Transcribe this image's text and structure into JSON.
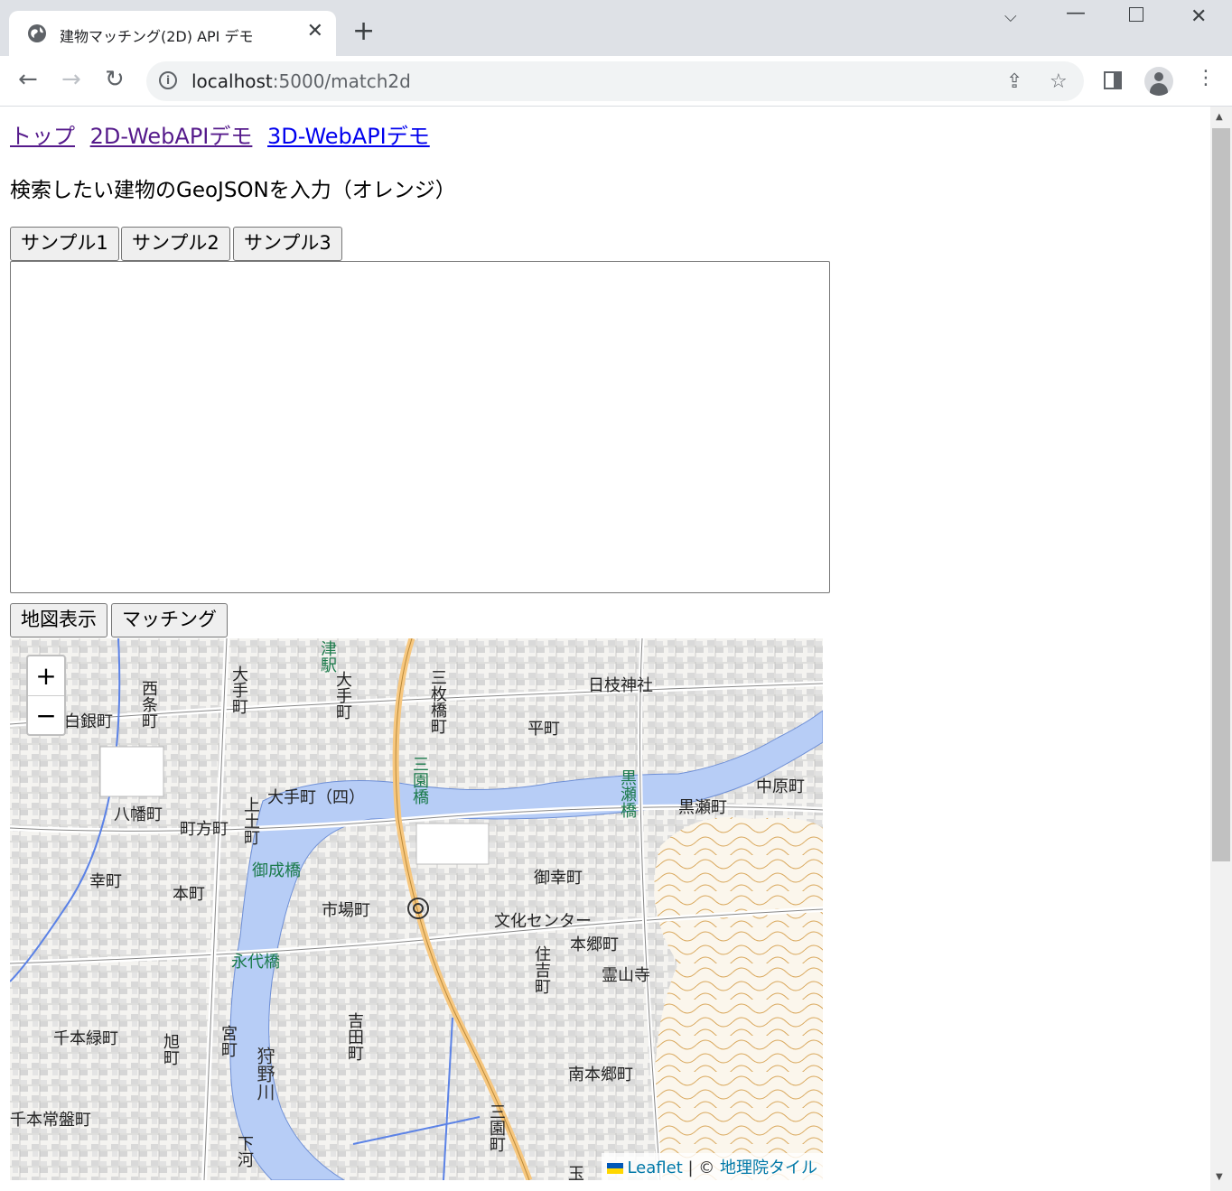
{
  "browser": {
    "tab_title": "建物マッチング(2D) API デモ",
    "tab_close": "✕",
    "new_tab": "+",
    "url_host": "localhost",
    "url_path": ":5000/match2d"
  },
  "nav_links": [
    {
      "label": "トップ",
      "visited": true
    },
    {
      "label": "2D-WebAPIデモ",
      "visited": true
    },
    {
      "label": "3D-WebAPIデモ",
      "visited": false
    }
  ],
  "heading": "検索したい建物のGeoJSONを入力（オレンジ）",
  "sample_buttons": [
    "サンプル1",
    "サンプル2",
    "サンプル3"
  ],
  "geojson_input": {
    "value": "",
    "placeholder": ""
  },
  "action_buttons": {
    "show_map": "地図表示",
    "matching": "マッチング"
  },
  "map": {
    "zoom_in": "+",
    "zoom_out": "−",
    "attribution_leaflet": "Leaflet",
    "attribution_sep": " | © ",
    "attribution_tiles": "地理院タイル",
    "river_color": "#b7cdf6",
    "road_color": "#f7c77e",
    "place_labels": [
      "津駅",
      "大手町",
      "三枚橋町",
      "日枝神社",
      "西条町",
      "白銀町",
      "平町",
      "大手町（四）",
      "中原町",
      "黒瀬町",
      "三園橋",
      "黒瀬橋",
      "八幡町",
      "町方町",
      "上土町",
      "御成橋",
      "御幸町",
      "幸町",
      "本町",
      "市場町",
      "文化センター",
      "本郷町",
      "住吉町",
      "霊山寺",
      "永代橋",
      "千本緑町",
      "旭町",
      "宮町",
      "吉田町",
      "狩野川",
      "南本郷町",
      "千本常盤町",
      "下河",
      "三園町",
      "玉"
    ]
  }
}
